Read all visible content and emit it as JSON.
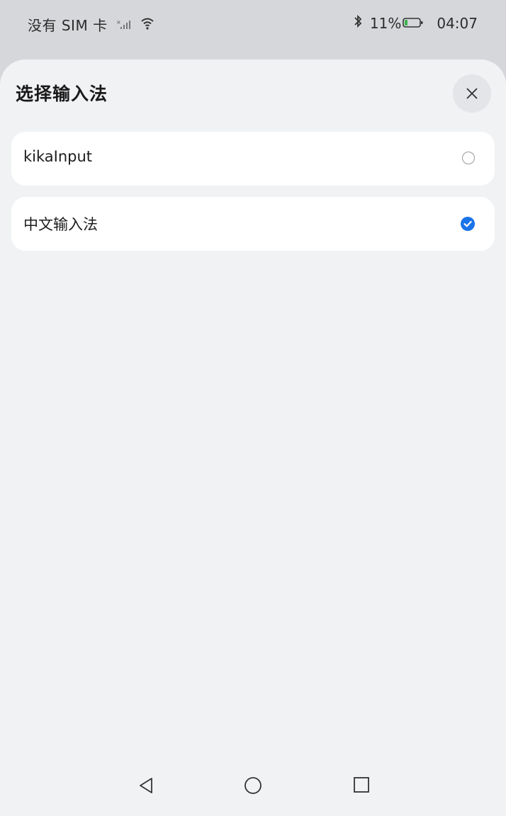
{
  "status_bar": {
    "carrier": "没有 SIM 卡",
    "signal_icon": "signal-bars-icon",
    "wifi_icon": "wifi-icon",
    "bluetooth_icon": "bluetooth-icon",
    "battery_percent": "11%",
    "battery_icon": "battery-low-icon",
    "time": "04:07"
  },
  "sheet": {
    "title": "选择输入法",
    "close_icon": "close-icon",
    "options": [
      {
        "label": "kikaInput",
        "selected": false
      },
      {
        "label": "中文输入法",
        "selected": true
      }
    ]
  },
  "nav_bar": {
    "back_icon": "back-triangle-icon",
    "home_icon": "home-circle-icon",
    "recent_icon": "recent-square-icon"
  },
  "colors": {
    "accent": "#1a73e8",
    "sheet_background": "#f1f2f4",
    "card_background": "#ffffff",
    "status_background": "#d6d7da"
  }
}
